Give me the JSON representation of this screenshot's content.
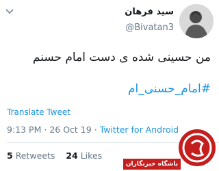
{
  "tweet": {
    "display_name": "سید فرهان",
    "handle": "@Bivatan3",
    "text": "من حسینی شده ی دست امام حسنم",
    "hashtag": "#امام_حسنی_ام",
    "translate_label": "Translate Tweet",
    "time": "9:13 PM",
    "separator": "·",
    "date": "26 Oct 19",
    "via": "·",
    "app": "Twitter for Android",
    "retweets_count": "5",
    "retweets_label": "Retweets",
    "likes_count": "24",
    "likes_label": "Likes"
  },
  "watermark": {
    "text": "باشگاه خبرنگاران"
  },
  "colors": {
    "link": "#1b95e0",
    "muted": "#657786",
    "watermark": "#c41e1e"
  },
  "icons": {
    "menu": "chevron-down-icon",
    "avatar": "avatar",
    "logo": "news-agency-logo-icon"
  }
}
